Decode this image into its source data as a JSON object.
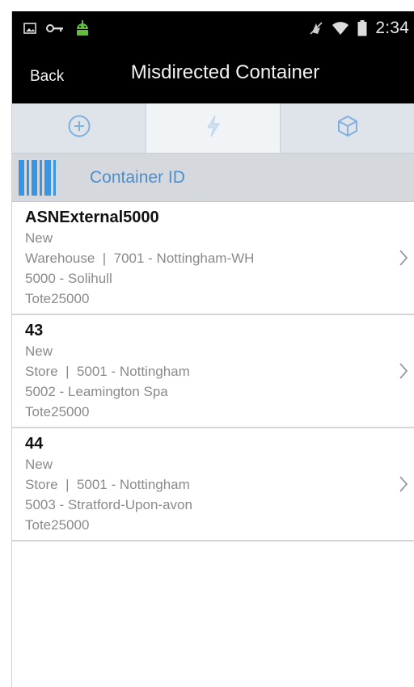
{
  "status_bar": {
    "time": "2:34",
    "icons": [
      "image-icon",
      "key-icon",
      "android-icon",
      "no-sound-icon",
      "wifi-icon",
      "battery-icon"
    ]
  },
  "header": {
    "back_label": "Back",
    "title": "Misdirected Container"
  },
  "tabs": [
    {
      "icon": "add-circle-icon",
      "active": false
    },
    {
      "icon": "lightning-icon",
      "active": true
    },
    {
      "icon": "cube-icon",
      "active": false
    }
  ],
  "scan": {
    "placeholder": "Container ID"
  },
  "containers": [
    {
      "id": "ASNExternal5000",
      "status": "New",
      "location": "Warehouse  |  7001 - Nottingham-WH",
      "destination": "5000 - Solihull",
      "container_type": "Tote25000"
    },
    {
      "id": "43",
      "status": "New",
      "location": "Store  |  5001 - Nottingham",
      "destination": "5002 - Leamington Spa",
      "container_type": "Tote25000"
    },
    {
      "id": "44",
      "status": "New",
      "location": "Store  |  5001 - Nottingham",
      "destination": "5003 - Stratford-Upon-avon",
      "container_type": "Tote25000"
    }
  ],
  "colors": {
    "accent": "#4a90d0",
    "header_bg": "#000000",
    "tab_bg": "#dfe4ea"
  }
}
